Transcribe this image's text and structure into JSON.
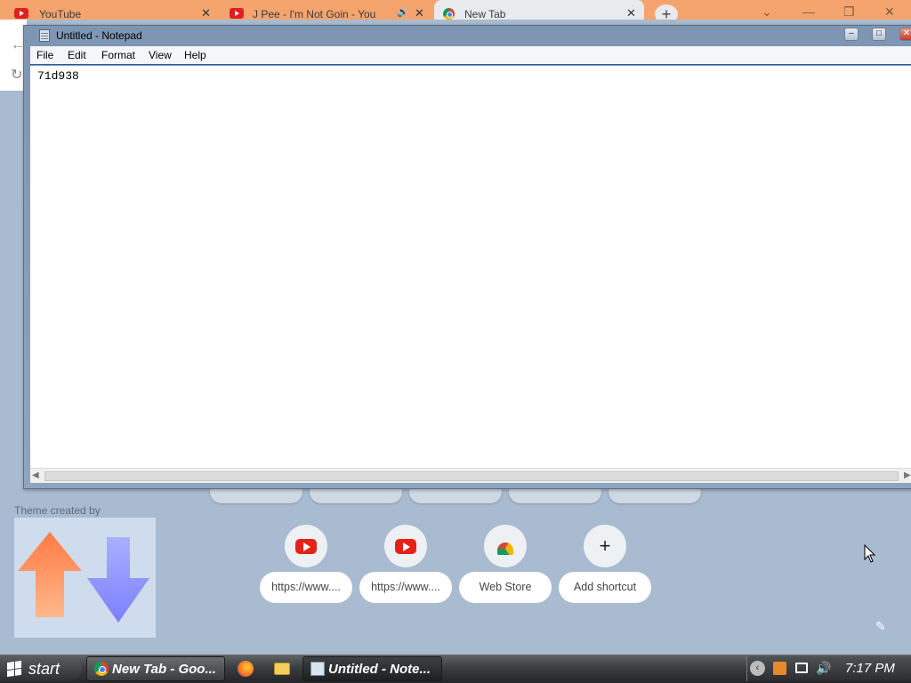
{
  "chrome": {
    "tabs": [
      {
        "title": "YouTube",
        "icon": "youtube-icon"
      },
      {
        "title": "J Pee - I'm Not Goin - You",
        "icon": "youtube-icon"
      },
      {
        "title": "New Tab",
        "icon": "chrome-icon"
      }
    ],
    "new_tab_glyph": "+",
    "window_controls": {
      "collapse": "⌄",
      "minimize": "—",
      "maximize": "❐",
      "close": "✕"
    },
    "theme_credit": "Theme created by",
    "shortcuts": [
      {
        "label": "https://www....",
        "icon": "youtube-icon"
      },
      {
        "label": "https://www....",
        "icon": "youtube-icon"
      },
      {
        "label": "Web Store",
        "icon": "webstore-icon"
      },
      {
        "label": "Add shortcut",
        "icon": "plus-icon",
        "glyph": "+"
      }
    ]
  },
  "notepad": {
    "title": "Untitled - Notepad",
    "menu": [
      "File",
      "Edit",
      "Format",
      "View",
      "Help"
    ],
    "content": "71d938",
    "controls": {
      "minimize": "–",
      "maximize": "□",
      "close": "✕"
    }
  },
  "taskbar": {
    "start_label": "start",
    "tasks": [
      {
        "label": "New Tab - Goo...",
        "icon": "chrome-icon"
      },
      {
        "label": "Untitled - Note...",
        "icon": "notepad-icon"
      }
    ],
    "tray_expand_glyph": "‹",
    "clock": "7:17 PM"
  },
  "colors": {
    "desktop_bg": "#a9bbd0",
    "tabstrip": "#f5a46e",
    "youtube_red": "#e62117",
    "taskbar_dark": "#232527"
  }
}
